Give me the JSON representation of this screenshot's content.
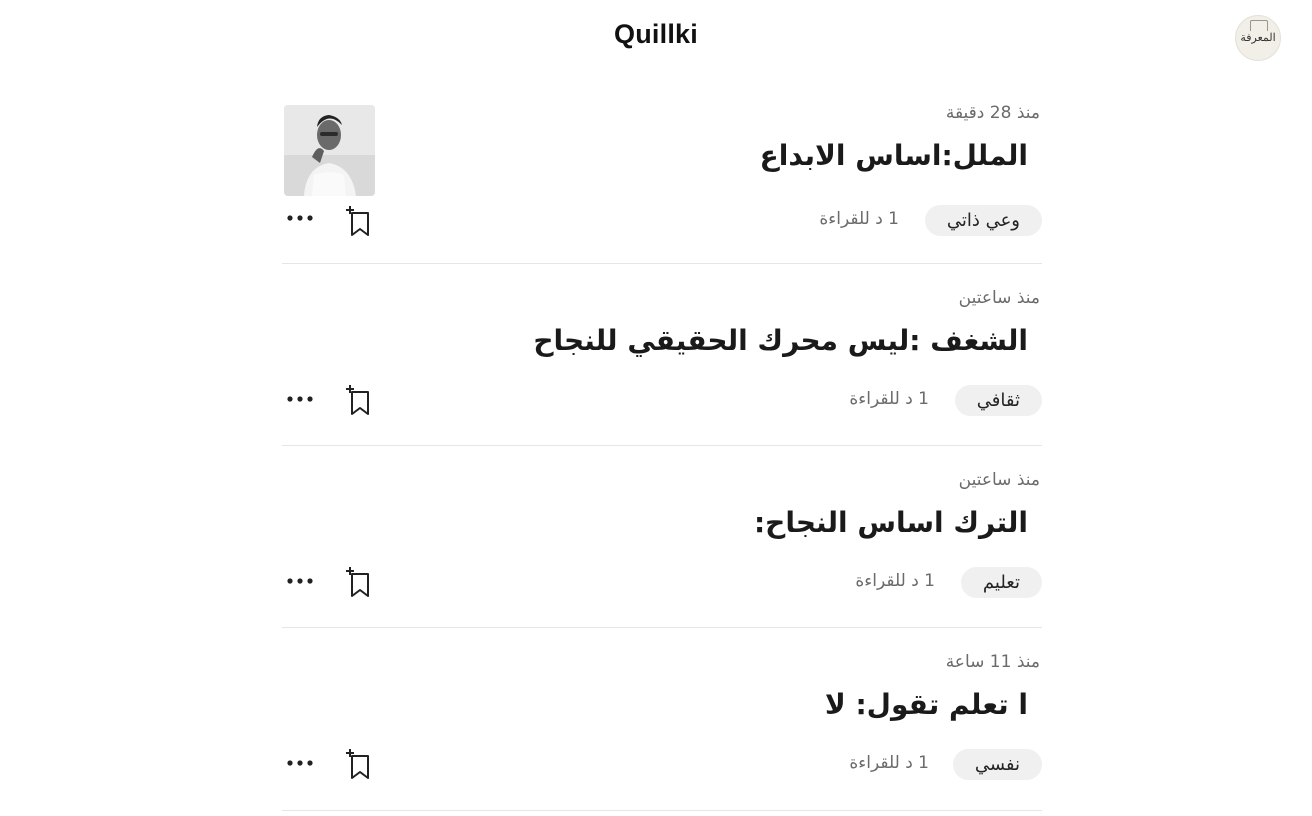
{
  "header": {
    "brand": "Quillki",
    "avatar_label": "المعرفة"
  },
  "posts": [
    {
      "time": "منذ 28 دقيقة",
      "title": "الملل:اساس الابداع",
      "tag": "وعي ذاتي",
      "read_time": "1 د للقراءة",
      "has_thumbnail": true,
      "thumbnail": "portrait-photo-icon"
    },
    {
      "time": "منذ ساعتين",
      "title": "الشغف :ليس محرك الحقيقي للنجاح",
      "tag": "ثقافي",
      "read_time": "1 د للقراءة",
      "has_thumbnail": false
    },
    {
      "time": "منذ ساعتين",
      "title": "الترك اساس النجاح:",
      "tag": "تعليم",
      "read_time": "1 د للقراءة",
      "has_thumbnail": false
    },
    {
      "time": "منذ 11 ساعة",
      "title": "ا تعلم تقول: لا",
      "tag": "نفسي",
      "read_time": "1 د للقراءة",
      "has_thumbnail": false
    }
  ],
  "icons": {
    "save": "bookmark-add-icon",
    "more": "more-horizontal-icon"
  },
  "colors": {
    "tag_bg": "#f0f0f0",
    "muted_text": "#6b6b6b",
    "divider": "#e6e6e6"
  }
}
